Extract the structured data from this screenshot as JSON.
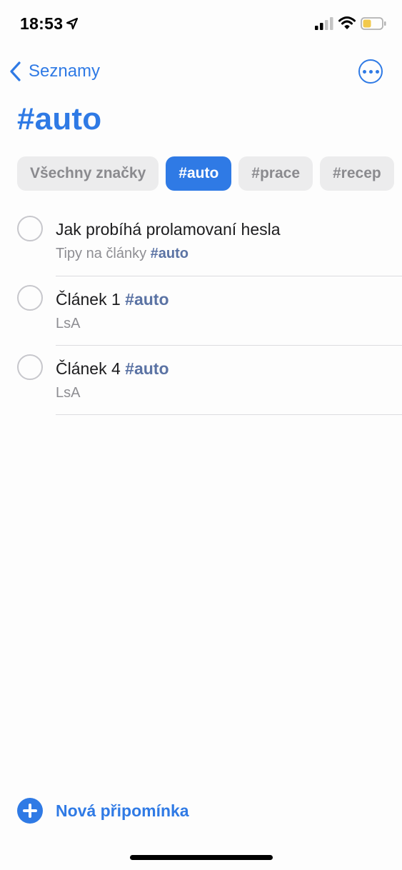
{
  "status_bar": {
    "time": "18:53",
    "icons": [
      "location-arrow-icon",
      "cellular-signal-icon",
      "wifi-icon",
      "battery-icon"
    ],
    "battery_color": "#f2c94c"
  },
  "nav": {
    "back_label": "Seznamy",
    "more_icon": "ellipsis-circle-icon"
  },
  "page": {
    "title": "#auto",
    "accent_color": "#2f7ae5"
  },
  "tags": [
    {
      "label": "Všechny značky",
      "active": false
    },
    {
      "label": "#auto",
      "active": true
    },
    {
      "label": "#prace",
      "active": false
    },
    {
      "label": "#recep",
      "active": false
    }
  ],
  "reminders": [
    {
      "title": "Jak probíhá prolamovaní hesla",
      "title_tag": "",
      "subtitle": "Tipy na články",
      "subtitle_tag": "#auto",
      "completed": false
    },
    {
      "title": "Článek 1",
      "title_tag": "#auto",
      "subtitle": "LsA",
      "subtitle_tag": "",
      "completed": false
    },
    {
      "title": "Článek 4",
      "title_tag": "#auto",
      "subtitle": "LsA",
      "subtitle_tag": "",
      "completed": false
    }
  ],
  "footer": {
    "new_reminder_label": "Nová připomínka",
    "icon": "plus-circle-icon"
  }
}
